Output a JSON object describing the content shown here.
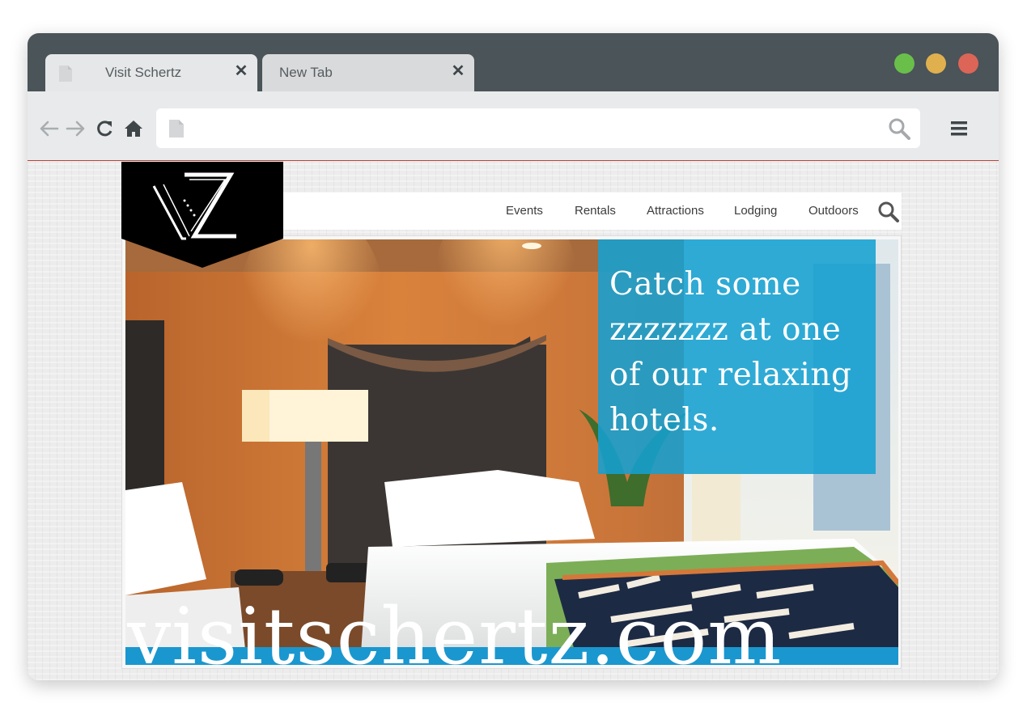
{
  "browser": {
    "tabs": [
      {
        "title": "Visit Schertz",
        "active": true
      },
      {
        "title": "New Tab",
        "active": false
      }
    ],
    "address_value": "",
    "icons": {
      "back": "arrow-left-icon",
      "forward": "arrow-right-icon",
      "reload": "reload-icon",
      "home": "home-icon",
      "menu": "hamburger-menu-icon",
      "search": "search-icon"
    },
    "colors": {
      "titlebar": "#4a5459",
      "traffic_green": "#6abf4b",
      "traffic_yellow": "#e0b04f",
      "traffic_red": "#dc6557"
    }
  },
  "site": {
    "logo_text": "VZ",
    "nav": [
      "Events",
      "Rentals",
      "Attractions",
      "Lodging",
      "Outdoors"
    ],
    "promo_text": "Catch some zzzzzzz at one of our relaxing hotels.",
    "domain_text": "visitschertz.com",
    "colors": {
      "accent_blue": "#1a97cf",
      "logo_bg": "#000000"
    }
  }
}
